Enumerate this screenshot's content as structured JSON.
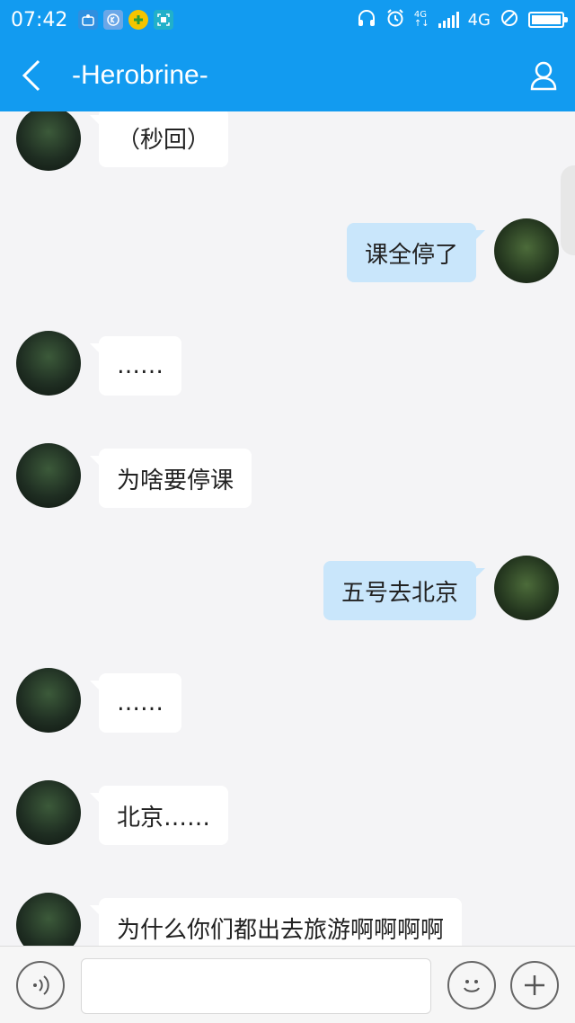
{
  "status_bar": {
    "time": "07:42",
    "notification_icons": [
      "app-icon",
      "k-icon",
      "plus-app-icon",
      "scan-icon"
    ],
    "right_icons": [
      "headphones-icon",
      "alarm-icon",
      "4g-small-icon",
      "signal-icon"
    ],
    "network_label": "4G",
    "accent": "#129bf0"
  },
  "header": {
    "title": "-Herobrine-"
  },
  "messages": [
    {
      "side": "left",
      "text": "（秒回）"
    },
    {
      "side": "right",
      "text": "课全停了"
    },
    {
      "side": "left",
      "text": "……"
    },
    {
      "side": "left",
      "text": "为啥要停课"
    },
    {
      "side": "right",
      "text": "五号去北京"
    },
    {
      "side": "left",
      "text": "……"
    },
    {
      "side": "left",
      "text": "北京……"
    },
    {
      "side": "left",
      "text": "为什么你们都出去旅游啊啊啊啊"
    }
  ],
  "input": {
    "value": "",
    "placeholder": ""
  },
  "colors": {
    "header_bg": "#129bf0",
    "incoming_bubble": "#ffffff",
    "outgoing_bubble": "#c9e6fb",
    "chat_bg": "#f4f4f6"
  }
}
